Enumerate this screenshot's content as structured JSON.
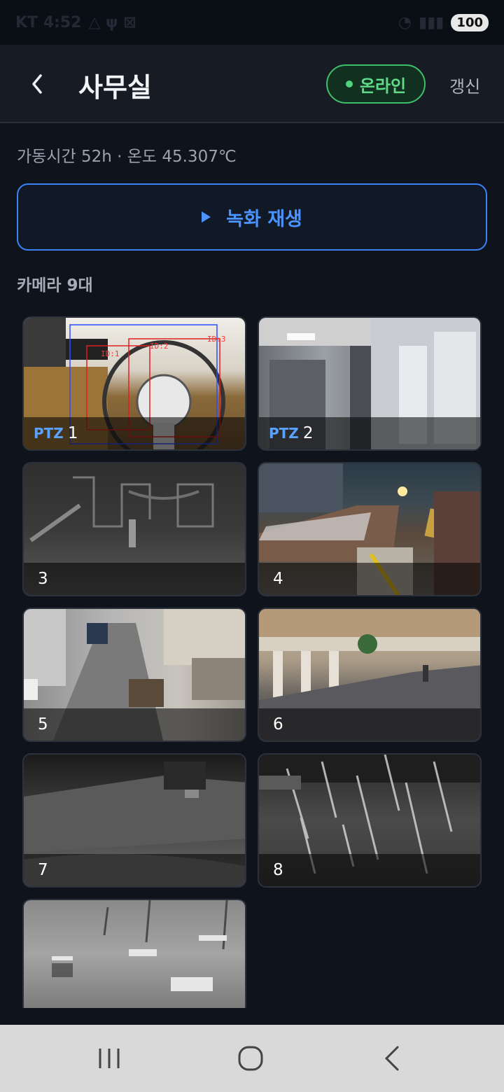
{
  "status_bar": {
    "carrier_time": "KT 4:52",
    "battery": "100"
  },
  "header": {
    "back_icon": "chevron-left-icon",
    "title": "사무실",
    "status_badge": "온라인",
    "status_color": "#4fd37c",
    "refresh_label": "갱신"
  },
  "stats": {
    "text": "가동시간 52h · 온도 45.307℃"
  },
  "record_button": {
    "icon": "play-icon",
    "label": "녹화 재생",
    "accent": "#3b82f6"
  },
  "camera_section": {
    "count_label": "카메라 9대",
    "cameras": [
      {
        "ptz": "PTZ",
        "number": "1",
        "overlay_ids": [
          "ID:1",
          "ID:2",
          "ID:3"
        ]
      },
      {
        "ptz": "PTZ",
        "number": "2"
      },
      {
        "ptz": "",
        "number": "3"
      },
      {
        "ptz": "",
        "number": "4"
      },
      {
        "ptz": "",
        "number": "5"
      },
      {
        "ptz": "",
        "number": "6"
      },
      {
        "ptz": "",
        "number": "7"
      },
      {
        "ptz": "",
        "number": "8"
      },
      {
        "ptz": "",
        "number": ""
      }
    ]
  },
  "nav_bar": {
    "recent_icon": "recent-apps-icon",
    "home_icon": "home-icon",
    "back_icon": "back-icon"
  }
}
